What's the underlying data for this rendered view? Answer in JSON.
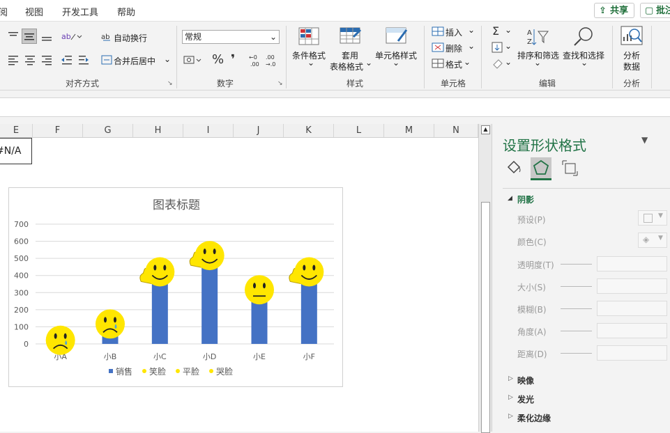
{
  "menu": {
    "items": [
      "阅",
      "视图",
      "开发工具",
      "帮助"
    ],
    "share_label": "共享",
    "comments_label": "批注"
  },
  "ribbon": {
    "alignment": {
      "wrap_text": "自动换行",
      "merge_center": "合并后居中",
      "group_label": "对齐方式"
    },
    "number": {
      "format_value": "常规",
      "percent_symbol": "%",
      "comma_symbol": "❜",
      "group_label": "数字"
    },
    "styles": {
      "conditional_format": "条件格式",
      "table_format_line1": "套用",
      "table_format_line2": "表格格式",
      "cell_styles": "单元格样式",
      "group_label": "样式"
    },
    "cells": {
      "insert": "插入",
      "delete": "删除",
      "format": "格式",
      "group_label": "单元格"
    },
    "editing": {
      "sort_filter": "排序和筛选",
      "find_select": "查找和选择",
      "group_label": "编辑"
    },
    "analysis": {
      "analyze_line1": "分析",
      "analyze_line2": "数据",
      "group_label": "分析"
    }
  },
  "sheet": {
    "columns": [
      "E",
      "F",
      "G",
      "H",
      "I",
      "J",
      "K",
      "L",
      "M",
      "N"
    ],
    "cell_e_value": "#N/A"
  },
  "chart_data": {
    "type": "bar",
    "title": "图表标题",
    "categories": [
      "小A",
      "小B",
      "小C",
      "小D",
      "小E",
      "小F"
    ],
    "series": [
      {
        "name": "销售",
        "values": [
          5,
          100,
          405,
          500,
          300,
          405
        ],
        "color": "#4472c4"
      }
    ],
    "markers": [
      {
        "category": "小A",
        "face": "sad"
      },
      {
        "category": "小B",
        "face": "sad"
      },
      {
        "category": "小C",
        "face": "smile-thumb"
      },
      {
        "category": "小D",
        "face": "smile-thumb"
      },
      {
        "category": "小E",
        "face": "neutral"
      },
      {
        "category": "小F",
        "face": "smile-thumb"
      }
    ],
    "ylim": [
      0,
      700
    ],
    "yticks": [
      "0",
      "100",
      "200",
      "300",
      "400",
      "500",
      "600",
      "700"
    ],
    "legend": [
      "销售",
      "笑脸",
      "平脸",
      "哭脸"
    ],
    "legend_position": "bottom",
    "grid": true,
    "face_color": "#ffe600"
  },
  "pane": {
    "title": "设置形状格式",
    "section_shadow": "阴影",
    "props": [
      "预设(P)",
      "颜色(C)",
      "透明度(T)",
      "大小(S)",
      "模糊(B)",
      "角度(A)",
      "距离(D)"
    ],
    "section_reflection": "映像",
    "section_glow": "发光",
    "section_soft_edges": "柔化边缘"
  },
  "colors": {
    "accent_green": "#217346",
    "bar_blue": "#4472c4"
  }
}
